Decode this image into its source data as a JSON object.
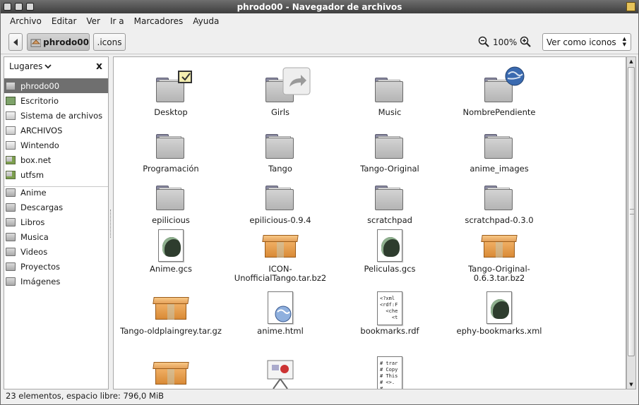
{
  "window": {
    "title": "phrodo00 - Navegador de archivos"
  },
  "menu": [
    "Archivo",
    "Editar",
    "Ver",
    "Ir a",
    "Marcadores",
    "Ayuda"
  ],
  "toolbar": {
    "path_home": "phrodo00",
    "path_current": ".icons",
    "zoom": "100%",
    "view_mode": "Ver como iconos"
  },
  "sidebar": {
    "title": "Lugares",
    "close": "x",
    "places": [
      {
        "label": "phrodo00",
        "icon": "home-folder-icon",
        "selected": true
      },
      {
        "label": "Escritorio",
        "icon": "desktop-icon"
      },
      {
        "label": "Sistema de archivos",
        "icon": "drive-icon"
      },
      {
        "label": "ARCHIVOS",
        "icon": "drive-icon"
      },
      {
        "label": "Wintendo",
        "icon": "drive-icon"
      },
      {
        "label": "box.net",
        "icon": "network-folder-icon"
      },
      {
        "label": "utfsm",
        "icon": "network-folder-icon"
      }
    ],
    "bookmarks": [
      {
        "label": "Anime",
        "icon": "folder-icon"
      },
      {
        "label": "Descargas",
        "icon": "folder-icon"
      },
      {
        "label": "Libros",
        "icon": "folder-icon"
      },
      {
        "label": "Musica",
        "icon": "folder-icon"
      },
      {
        "label": "Videos",
        "icon": "folder-icon"
      },
      {
        "label": "Proyectos",
        "icon": "folder-icon"
      },
      {
        "label": "Imágenes",
        "icon": "folder-icon"
      }
    ]
  },
  "files": [
    {
      "name": "Desktop",
      "type": "folder",
      "emblem": "note-emblem"
    },
    {
      "name": "Girls",
      "type": "folder",
      "emblem": "symlink-emblem"
    },
    {
      "name": "Music",
      "type": "folder"
    },
    {
      "name": "NombrePendiente",
      "type": "folder",
      "emblem": "web-emblem"
    },
    {
      "name": "Programación",
      "type": "folder"
    },
    {
      "name": "Tango",
      "type": "folder"
    },
    {
      "name": "Tango-Original",
      "type": "folder"
    },
    {
      "name": "anime_images",
      "type": "folder"
    },
    {
      "name": "epilicious",
      "type": "folder"
    },
    {
      "name": "epilicious-0.9.4",
      "type": "folder"
    },
    {
      "name": "scratchpad",
      "type": "folder"
    },
    {
      "name": "scratchpad-0.3.0",
      "type": "folder"
    },
    {
      "name": "Anime.gcs",
      "type": "gcs"
    },
    {
      "name": "ICON-UnofficialTango.tar.bz2",
      "type": "archive"
    },
    {
      "name": "Peliculas.gcs",
      "type": "gcs"
    },
    {
      "name": "Tango-Original-0.6.3.tar.bz2",
      "type": "archive"
    },
    {
      "name": "Tango-oldplaingrey.tar.gz",
      "type": "archive"
    },
    {
      "name": "anime.html",
      "type": "html"
    },
    {
      "name": "bookmarks.rdf",
      "type": "text",
      "preview": "<?xml\n<rdf:F\n  <che\n    <t"
    },
    {
      "name": "ephy-bookmarks.xml",
      "type": "gcs"
    },
    {
      "name": "",
      "type": "archive"
    },
    {
      "name": "",
      "type": "presentation"
    },
    {
      "name": "",
      "type": "text",
      "preview": "# trar\n# Copy\n# This\n# <>.\n#"
    }
  ],
  "status": "23 elementos, espacio libre: 796,0 MiB"
}
